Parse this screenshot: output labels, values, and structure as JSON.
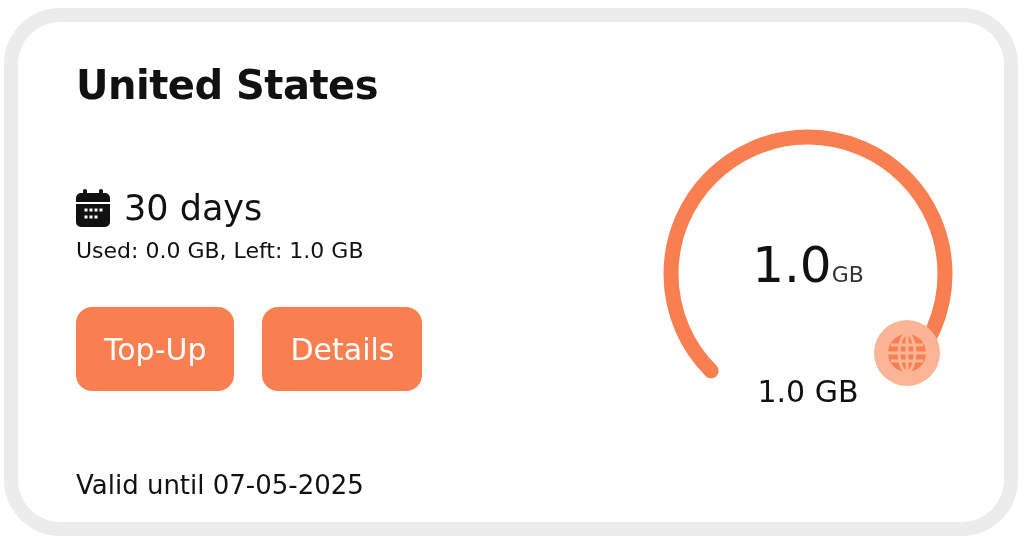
{
  "card": {
    "title": "United States",
    "duration": "30 days",
    "usage": "Used: 0.0 GB, Left: 1.0 GB",
    "buttons": [
      {
        "label": "Top-Up"
      },
      {
        "label": "Details"
      }
    ],
    "validity": "Valid until 07-05-2025"
  },
  "gauge": {
    "amount": "1.0",
    "unit": "GB",
    "total": "1.0 GB"
  }
}
